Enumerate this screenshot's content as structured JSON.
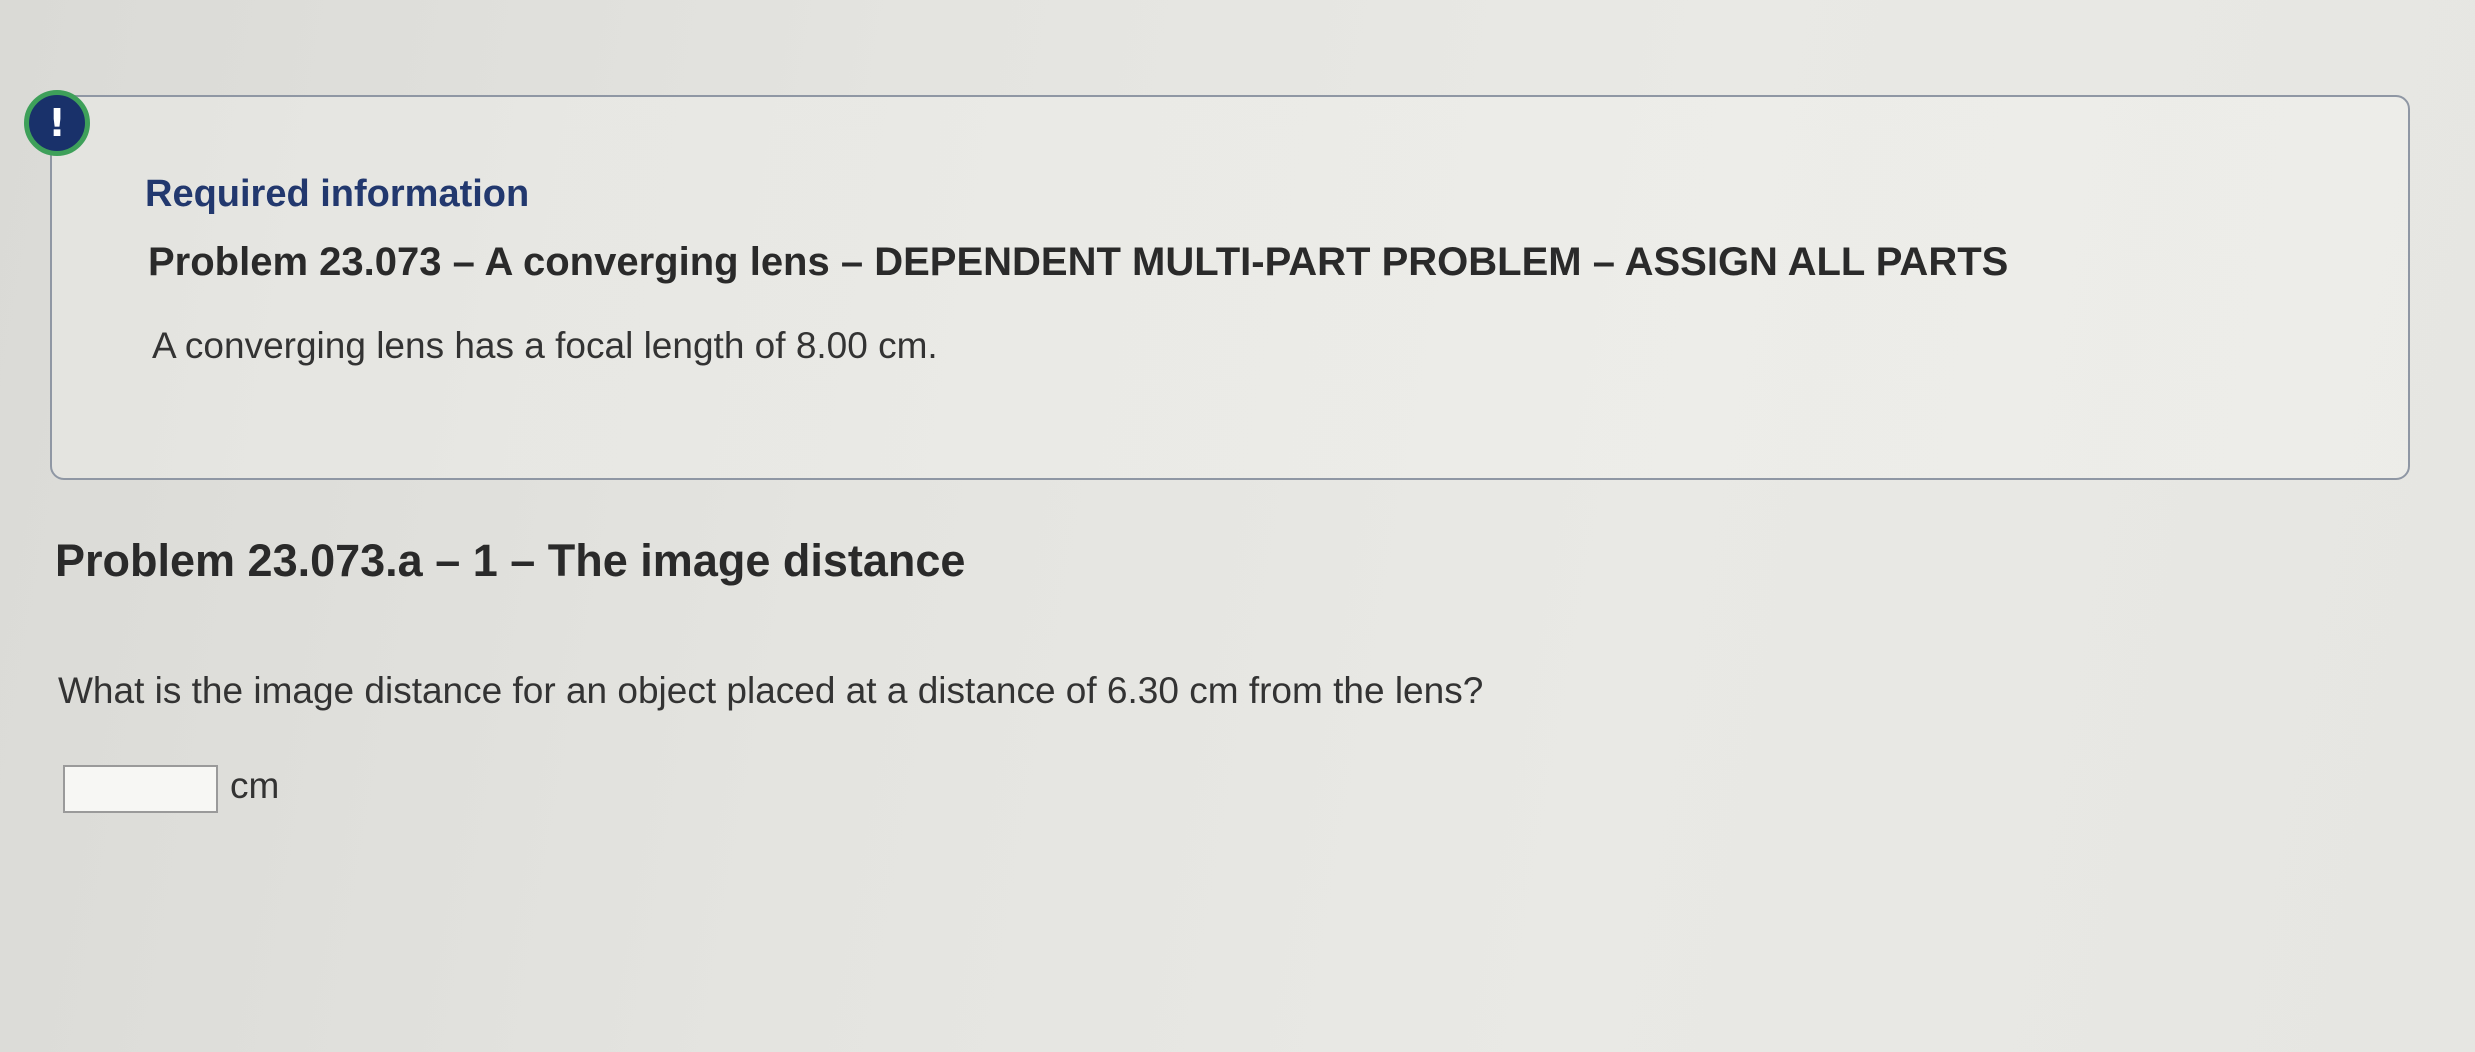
{
  "alert": {
    "icon": "exclamation-icon",
    "glyph": "!"
  },
  "required_info": {
    "label": "Required information",
    "problem_title": "Problem 23.073 – A converging lens – DEPENDENT MULTI-PART PROBLEM – ASSIGN ALL PARTS",
    "statement": "A converging lens has a focal length of 8.00 cm."
  },
  "part": {
    "title": "Problem 23.073.a – 1 – The image distance",
    "question": "What is the image distance for an object placed at a distance of 6.30 cm from the lens?",
    "answer_value": "",
    "unit": "cm"
  },
  "colors": {
    "alert_fill": "#19316a",
    "alert_ring": "#3ea05a",
    "label_blue": "#22386e",
    "box_border": "#8f97a4"
  }
}
